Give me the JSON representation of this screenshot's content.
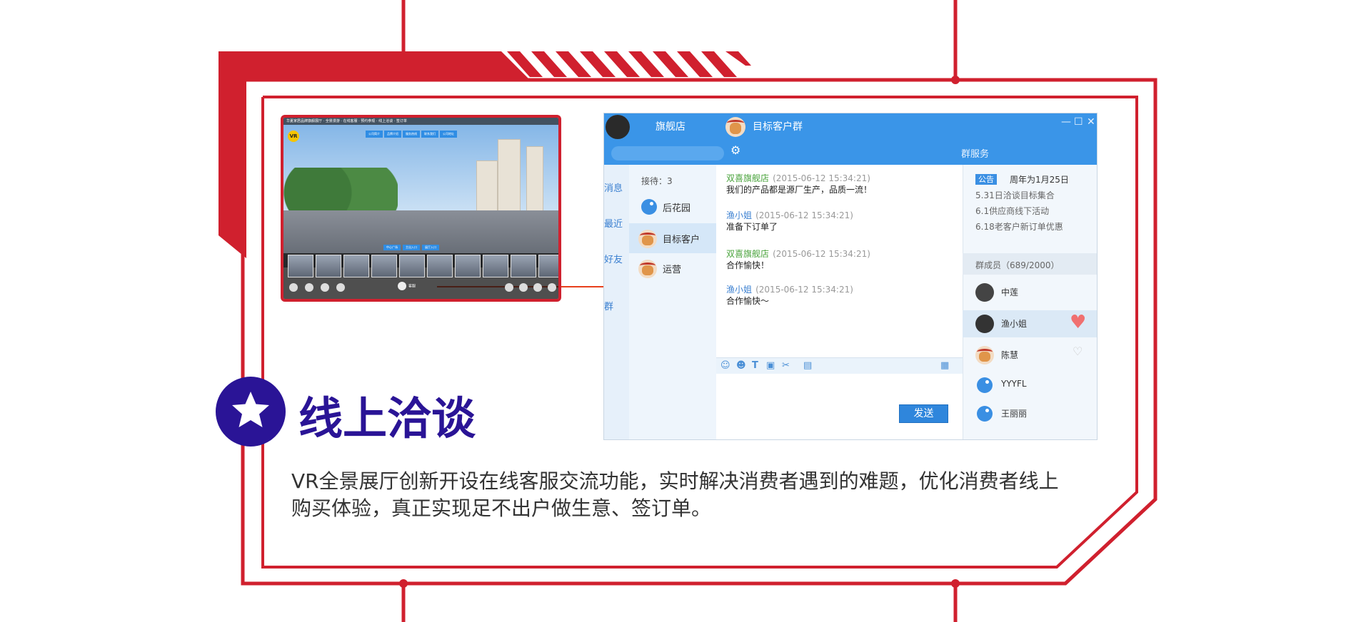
{
  "colors": {
    "frame_red": "#d0202e",
    "headline_indigo": "#2a1496",
    "chat_blue": "#3a95e8",
    "arrow_red": "#e8401c"
  },
  "icons": {
    "badge": "star-icon"
  },
  "vr_panel": {
    "logo": "VR",
    "top_text": "华夏家居品牌旗舰展厅 · 全景漫游 · 在线客服 · 预约参观 · 线上洽谈 · 签订单",
    "menu": [
      "公司简介",
      "品牌介绍",
      "服务热线",
      "联系我们",
      "公司地址"
    ],
    "tabs": [
      "中心广场",
      "主出入口",
      "展厅入口"
    ],
    "agent": "客服"
  },
  "chat": {
    "store_name": "旗舰店",
    "group_title": "目标客户群",
    "group_service": "群服务",
    "nav": [
      "消息",
      "最近",
      "好友",
      "群"
    ],
    "receiving": "接待：3",
    "contacts": [
      "后花园",
      "目标客户",
      "运营"
    ],
    "messages": [
      {
        "sender": "双喜旗舰店",
        "time": "(2015-06-12 15:34:21)",
        "text": "我们的产品都是源厂生产，品质一流！"
      },
      {
        "sender": "渔小姐",
        "time": "(2015-06-12 15:34:21)",
        "text": "准备下订单了"
      },
      {
        "sender": "双喜旗舰店",
        "time": "(2015-06-12 15:34:21)",
        "text": "合作愉快！"
      },
      {
        "sender": "渔小姐",
        "time": "(2015-06-12 15:34:21)",
        "text": "合作愉快～"
      }
    ],
    "send": "发送",
    "notice_tag": "公告",
    "notice_title": "周年为1月25日",
    "notices": [
      "5.31日洽谈目标集合",
      "6.1供应商线下活动",
      "6.18老客户新订单优惠"
    ],
    "members_label": "群成员（689/2000）",
    "members": [
      "中莲",
      "渔小姐",
      "陈慧",
      "YYYFL",
      "王丽丽"
    ]
  },
  "headline": "线上洽谈",
  "description": "VR全景展厅创新开设在线客服交流功能，实时解决消费者遇到的难题，优化消费者线上购买体验，真正实现足不出户做生意、签订单。"
}
